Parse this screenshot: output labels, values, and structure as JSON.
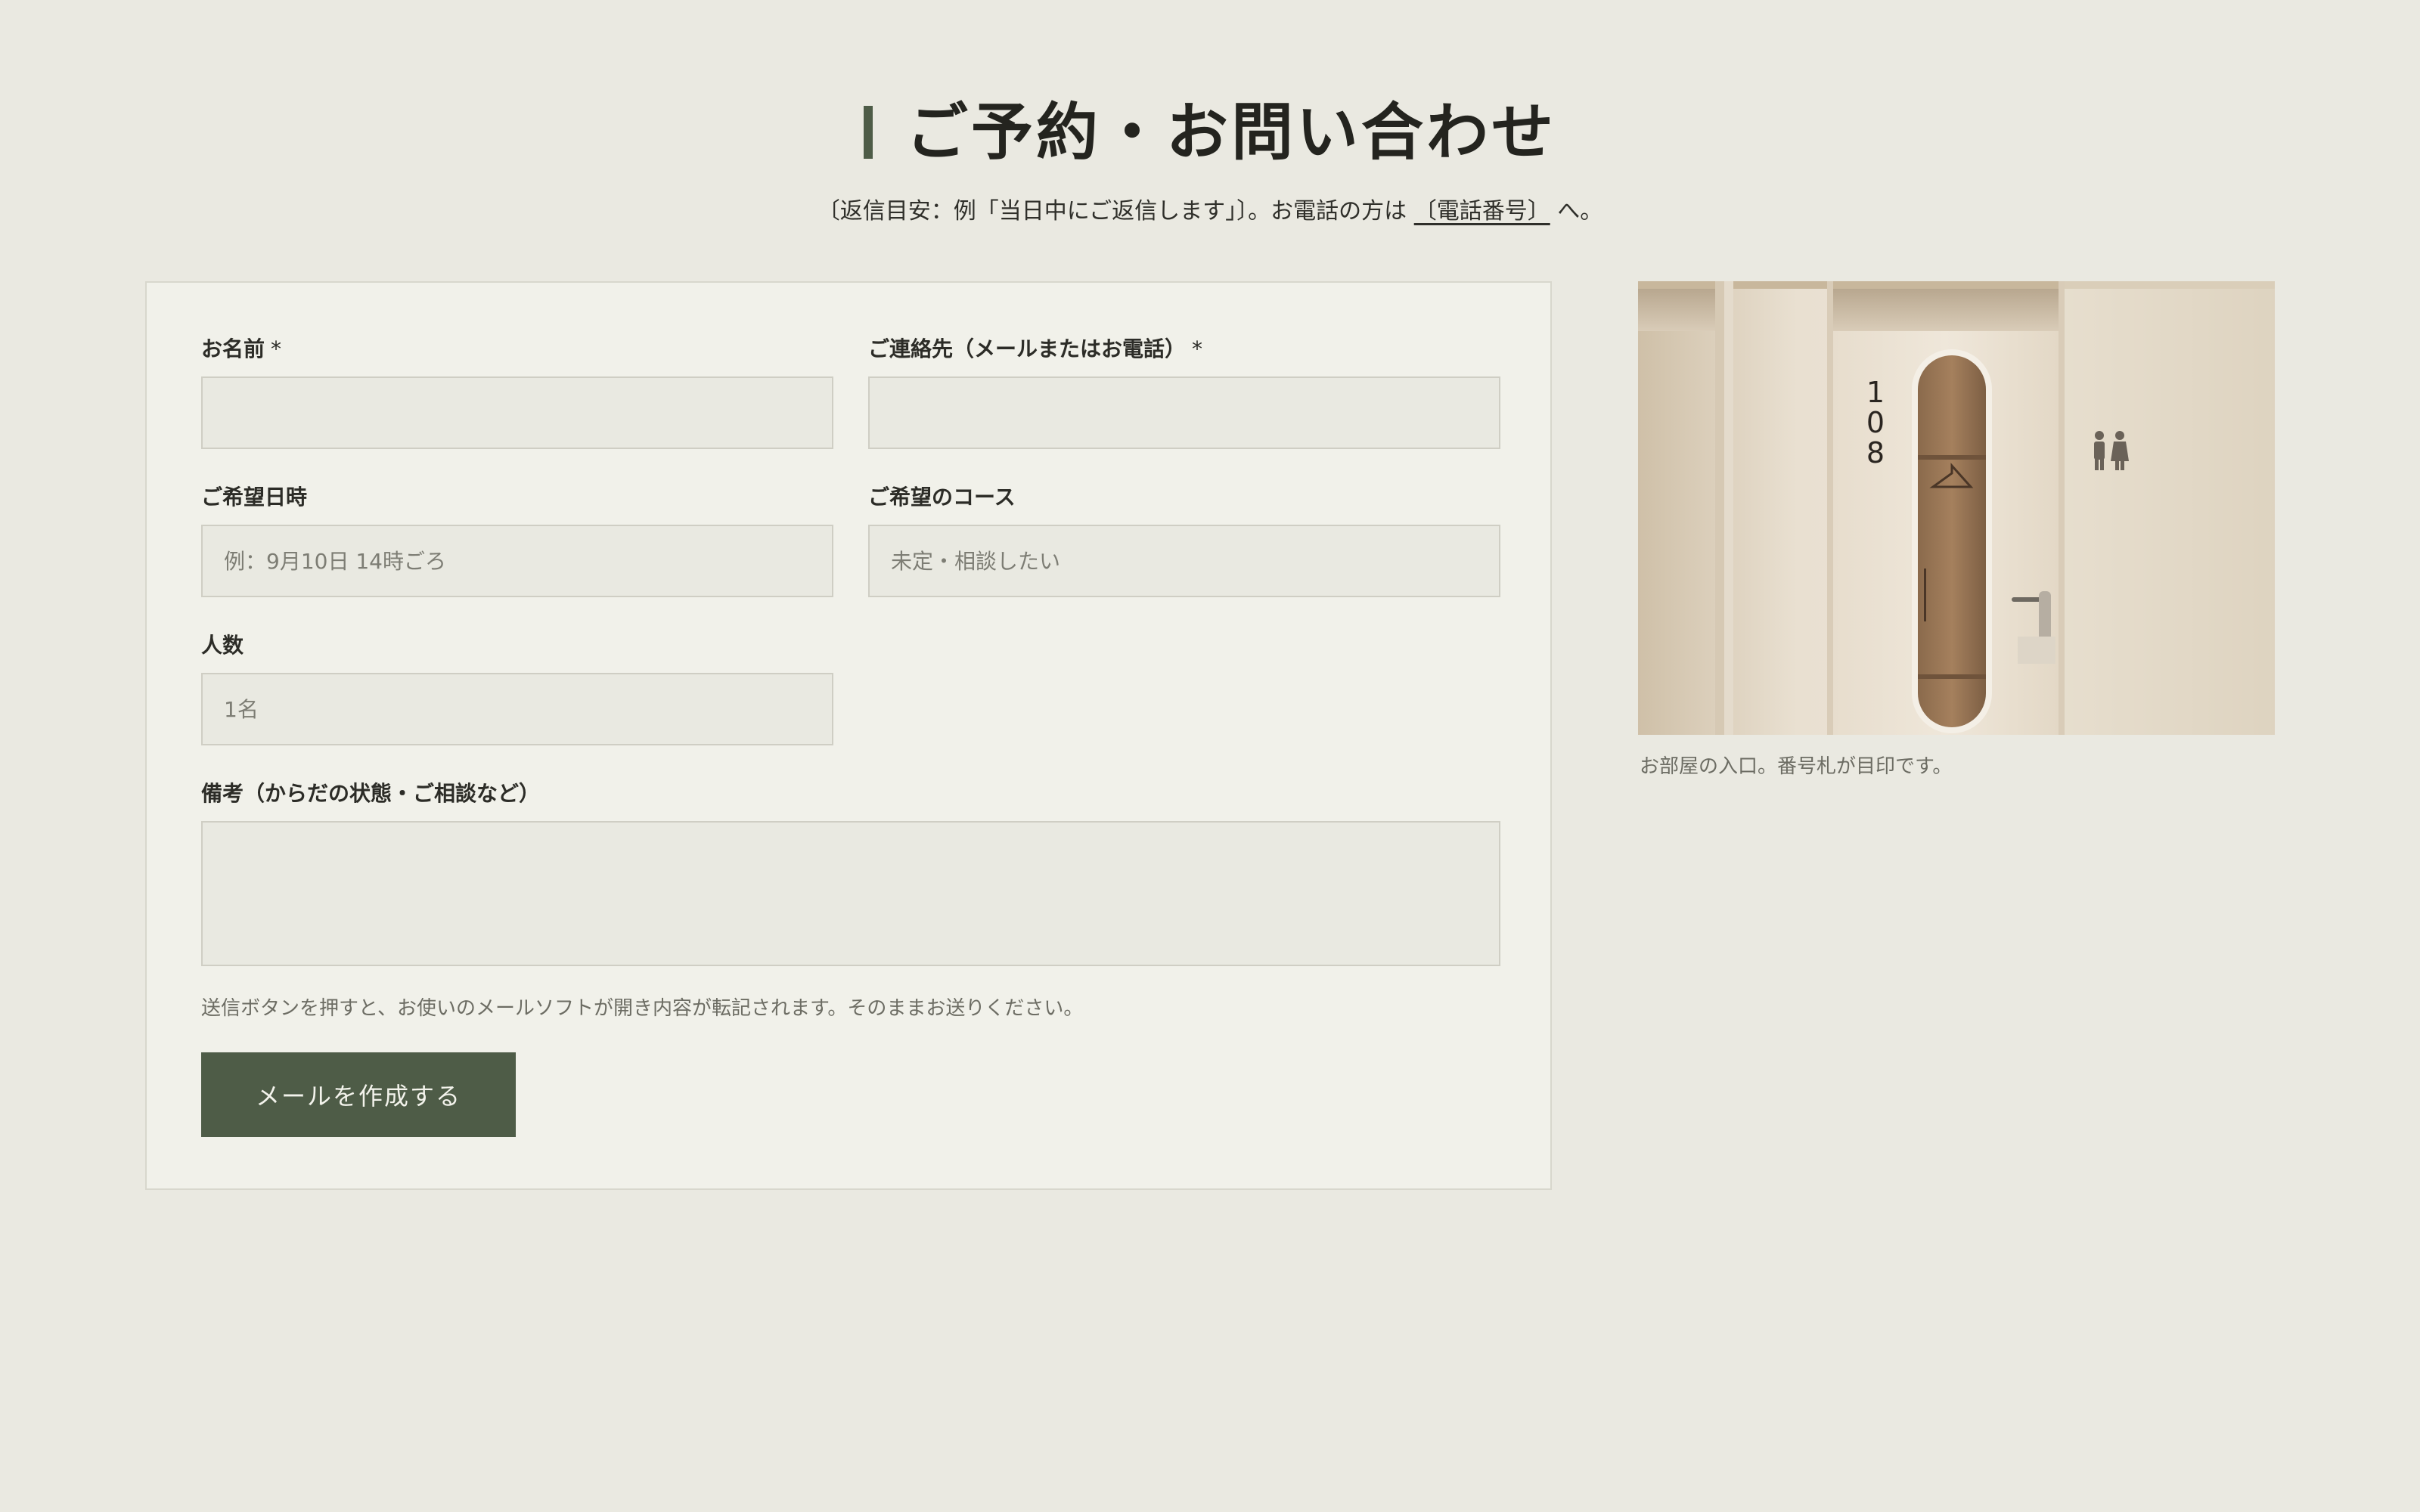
{
  "header": {
    "title": "ご予約・お問い合わせ",
    "subtitle_prefix": "〔返信目安：例「当日中にご返信します」〕。お電話の方は",
    "phone_link": "〔電話番号〕",
    "subtitle_suffix": "へ。"
  },
  "form": {
    "name": {
      "label": "お名前",
      "required_mark": "*",
      "value": "",
      "placeholder": ""
    },
    "contact": {
      "label": "ご連絡先（メールまたはお電話）",
      "required_mark": "*",
      "value": "",
      "placeholder": ""
    },
    "date": {
      "label": "ご希望日時",
      "value": "",
      "placeholder": "例：9月10日 14時ごろ"
    },
    "course": {
      "label": "ご希望のコース",
      "value": "",
      "placeholder": "未定・相談したい"
    },
    "people": {
      "label": "人数",
      "value": "",
      "placeholder": "1名"
    },
    "notes": {
      "label": "備考（からだの状態・ご相談など）",
      "value": "",
      "placeholder": ""
    },
    "note_text": "送信ボタンを押すと、お使いのメールソフトが開き内容が転記されます。そのままお送りください。",
    "submit_label": "メールを作成する"
  },
  "photo": {
    "room_number_digits": [
      "1",
      "0",
      "8"
    ],
    "caption": "お部屋の入口。番号札が目印です。"
  },
  "colors": {
    "page_background": "#eae9e1",
    "card_background": "#f1f1ea",
    "accent": "#4e5c47",
    "field_background": "#e9e9e1"
  }
}
